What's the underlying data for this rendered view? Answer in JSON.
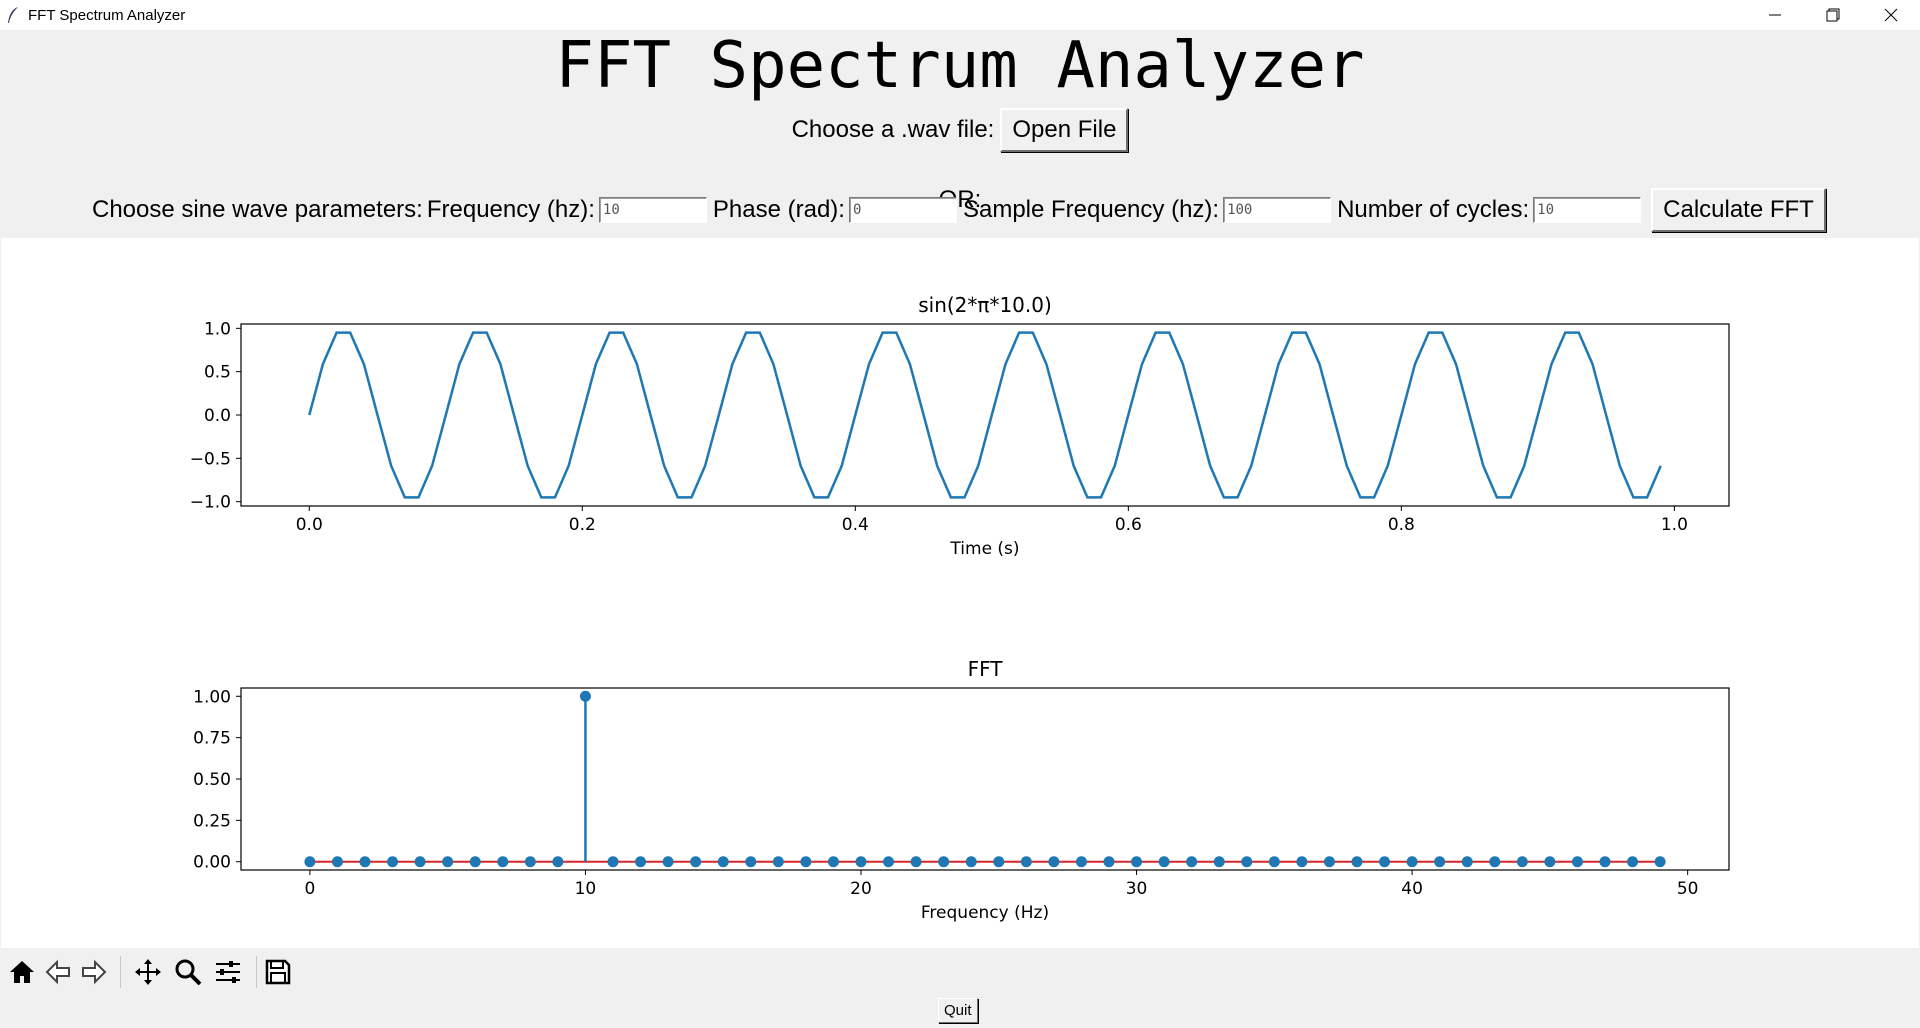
{
  "window": {
    "title": "FFT Spectrum Analyzer"
  },
  "header": {
    "app_title": "FFT Spectrum Analyzer",
    "choose_file_label": "Choose a .wav file:",
    "open_file_button": "Open File",
    "or_label": "OR:",
    "sine_params_label": "Choose sine wave parameters:",
    "frequency_label": "Frequency (hz):",
    "frequency_value": "10",
    "phase_label": "Phase (rad):",
    "phase_value": "0",
    "sample_freq_label": "Sample Frequency (hz):",
    "sample_freq_value": "100",
    "cycles_label": "Number of cycles:",
    "cycles_value": "10",
    "calculate_button": "Calculate FFT"
  },
  "chart_data": [
    {
      "type": "line",
      "title": "sin(2*π*10.0)",
      "xlabel": "Time (s)",
      "ylabel": "",
      "xlim": [
        -0.05,
        1.04
      ],
      "ylim": [
        -1.05,
        1.05
      ],
      "xticks": [
        "0.0",
        "0.2",
        "0.4",
        "0.6",
        "0.8",
        "1.0"
      ],
      "yticks": [
        "−1.0",
        "−0.5",
        "0.0",
        "0.5",
        "1.0"
      ],
      "series": [
        {
          "frequency_hz": 10,
          "phase_rad": 0,
          "sample_rate_hz": 100,
          "cycles": 10,
          "color": "#1f77b4",
          "note_x_range": [
            0.0,
            0.99
          ]
        }
      ]
    },
    {
      "type": "stem",
      "title": "FFT",
      "xlabel": "Frequency (Hz)",
      "ylabel": "",
      "xlim": [
        -2.5,
        51.5
      ],
      "ylim": [
        -0.05,
        1.05
      ],
      "xticks": [
        "0",
        "10",
        "20",
        "30",
        "40",
        "50"
      ],
      "yticks": [
        "0.00",
        "0.25",
        "0.50",
        "0.75",
        "1.00"
      ],
      "x": [
        0,
        1,
        2,
        3,
        4,
        5,
        6,
        7,
        8,
        9,
        10,
        11,
        12,
        13,
        14,
        15,
        16,
        17,
        18,
        19,
        20,
        21,
        22,
        23,
        24,
        25,
        26,
        27,
        28,
        29,
        30,
        31,
        32,
        33,
        34,
        35,
        36,
        37,
        38,
        39,
        40,
        41,
        42,
        43,
        44,
        45,
        46,
        47,
        48,
        49
      ],
      "values": [
        0,
        0,
        0,
        0,
        0,
        0,
        0,
        0,
        0,
        0,
        1.0,
        0,
        0,
        0,
        0,
        0,
        0,
        0,
        0,
        0,
        0,
        0,
        0,
        0,
        0,
        0,
        0,
        0,
        0,
        0,
        0,
        0,
        0,
        0,
        0,
        0,
        0,
        0,
        0,
        0,
        0,
        0,
        0,
        0,
        0,
        0,
        0,
        0,
        0,
        0
      ],
      "marker_color": "#1f77b4",
      "baseline_color": "#d62728"
    }
  ],
  "toolbar": {
    "icons": [
      "home-icon",
      "back-arrow-icon",
      "forward-arrow-icon",
      "pan-icon",
      "zoom-icon",
      "configure-subplots-icon",
      "save-icon"
    ]
  },
  "quit_button": "Quit"
}
